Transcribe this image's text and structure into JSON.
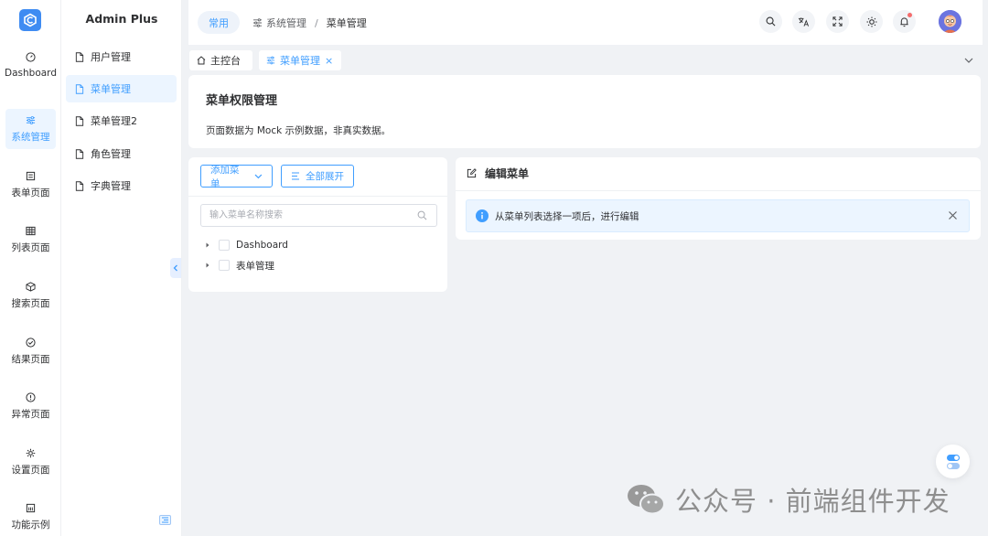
{
  "brand": {
    "title": "Admin Plus",
    "accent": "#409eff",
    "logo_color": "#3f8cf2"
  },
  "rail": {
    "items": [
      {
        "label": "Dashboard",
        "icon": "gauge-icon",
        "active": false
      },
      {
        "label": "系统管理",
        "icon": "sliders-icon",
        "active": true
      },
      {
        "label": "表单页面",
        "icon": "form-icon",
        "active": false
      },
      {
        "label": "列表页面",
        "icon": "grid-icon",
        "active": false
      },
      {
        "label": "搜索页面",
        "icon": "cube-icon",
        "active": false
      },
      {
        "label": "结果页面",
        "icon": "check-circle-icon",
        "active": false
      },
      {
        "label": "异常页面",
        "icon": "warning-circle-icon",
        "active": false
      },
      {
        "label": "设置页面",
        "icon": "gear-icon",
        "active": false
      },
      {
        "label": "功能示例",
        "icon": "calendar-icon",
        "active": false
      }
    ]
  },
  "sidebar": {
    "items": [
      {
        "label": "用户管理",
        "active": false
      },
      {
        "label": "菜单管理",
        "active": true
      },
      {
        "label": "菜单管理2",
        "active": false
      },
      {
        "label": "角色管理",
        "active": false
      },
      {
        "label": "字典管理",
        "active": false
      }
    ]
  },
  "header": {
    "pill": "常用",
    "breadcrumb": {
      "parent": "系统管理",
      "sep": "/",
      "current": "菜单管理"
    }
  },
  "tabs": [
    {
      "label": "主控台",
      "icon": "home-icon",
      "active": false
    },
    {
      "label": "菜单管理",
      "icon": "sliders-icon",
      "active": true,
      "close": "×"
    }
  ],
  "page": {
    "title": "菜单权限管理",
    "desc": "页面数据为 Mock 示例数据，非真实数据。"
  },
  "tree_panel": {
    "add_button": "添加菜单",
    "expand_button": "全部展开",
    "search_placeholder": "输入菜单名称搜索",
    "nodes": [
      {
        "label": "Dashboard"
      },
      {
        "label": "表单管理"
      }
    ]
  },
  "edit_panel": {
    "title": "编辑菜单",
    "alert": "从菜单列表选择一项后，进行编辑"
  },
  "watermark": {
    "text": "公众号 · 前端组件开发"
  }
}
